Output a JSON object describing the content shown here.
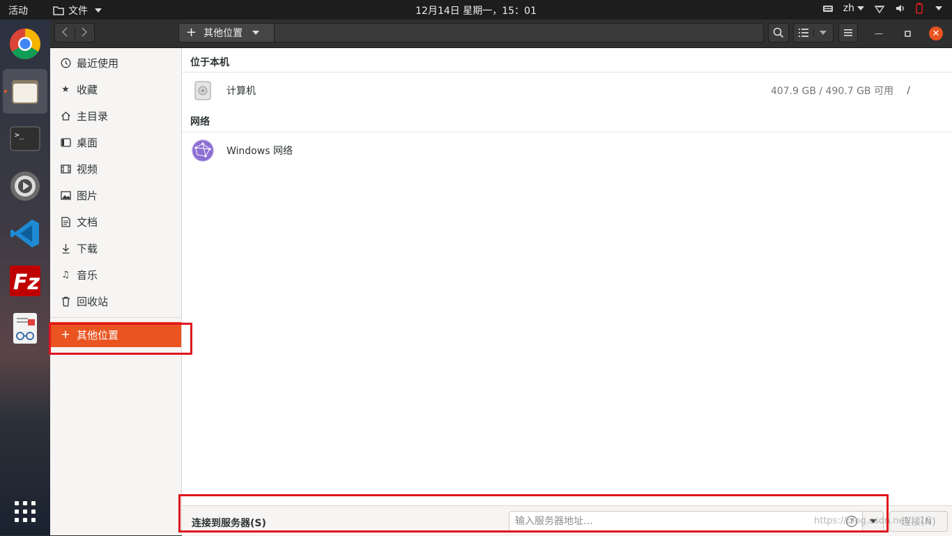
{
  "topbar": {
    "activities": "活动",
    "app_menu": "文件",
    "clock": "12月14日 星期一，15：01",
    "input_method": "zh"
  },
  "dock": {
    "items": [
      "chrome",
      "files",
      "terminal",
      "settings",
      "vscode",
      "filezilla",
      "document-viewer"
    ]
  },
  "header": {
    "location": "其他位置"
  },
  "sidebar": {
    "items": [
      {
        "label": "最近使用",
        "icon": "clock-icon"
      },
      {
        "label": "收藏",
        "icon": "star-icon"
      },
      {
        "label": "主目录",
        "icon": "home-icon"
      },
      {
        "label": "桌面",
        "icon": "desktop-icon"
      },
      {
        "label": "视频",
        "icon": "video-icon"
      },
      {
        "label": "图片",
        "icon": "image-icon"
      },
      {
        "label": "文档",
        "icon": "document-icon"
      },
      {
        "label": "下载",
        "icon": "download-icon"
      },
      {
        "label": "音乐",
        "icon": "music-icon"
      },
      {
        "label": "回收站",
        "icon": "trash-icon"
      }
    ],
    "other_locations": "其他位置"
  },
  "main": {
    "local_title": "位于本机",
    "computer": {
      "name": "计算机",
      "usage": "407.9 GB / 490.7 GB 可用",
      "path": "/"
    },
    "network_title": "网络",
    "network": {
      "name": "Windows 网络"
    }
  },
  "connect": {
    "label": "连接到服务器(S)",
    "placeholder": "输入服务器地址…",
    "button": "连接(N)"
  },
  "watermark": "https://blog.csdn.net/...16",
  "colors": {
    "accent": "#e95420",
    "annotation": "#e0141e",
    "topbar": "#1d1d1d",
    "sidebar_bg": "#f6f5f4"
  }
}
